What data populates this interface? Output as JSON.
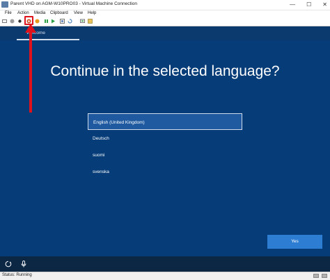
{
  "window": {
    "title": "Parent VHD on AGM-W10PRO03 - Virtual Machine Connection",
    "minimize_glyph": "—",
    "maximize_glyph": "☐",
    "close_glyph": "✕"
  },
  "menu": {
    "items": [
      "File",
      "Action",
      "Media",
      "Clipboard",
      "View",
      "Help"
    ]
  },
  "colors": {
    "guest_bg": "#063d79",
    "accent": "#2d7dd2",
    "highlight": "#e0121b"
  },
  "guest": {
    "tab": "Welcome",
    "heading": "Continue in the selected language?",
    "languages": [
      "English (United Kingdom)",
      "Deutsch",
      "suomi",
      "svenska"
    ],
    "selected_language": "English (United Kingdom)",
    "yes_label": "Yes"
  },
  "status": {
    "text": "Status: Running"
  }
}
